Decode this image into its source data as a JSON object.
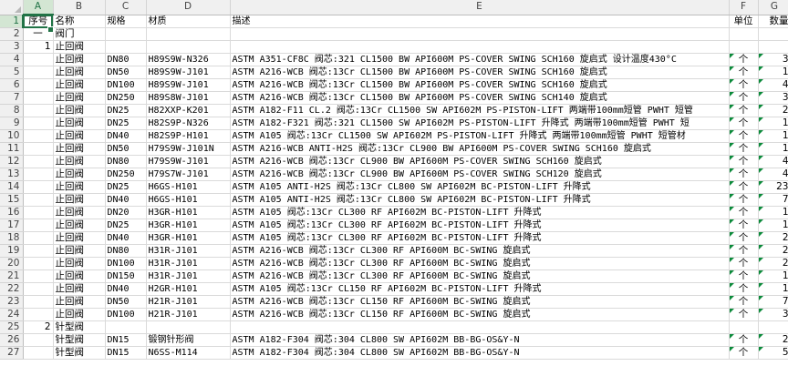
{
  "columns": [
    "A",
    "B",
    "C",
    "D",
    "E",
    "F",
    "G"
  ],
  "rows": [
    {
      "n": "1",
      "a": "序号",
      "b": "名称",
      "c": "规格",
      "d": "材质",
      "e": "描述",
      "f": "单位",
      "g": "数量"
    },
    {
      "n": "2",
      "a": "一",
      "b": "阀门",
      "c": "",
      "d": "",
      "e": "",
      "f": "",
      "g": ""
    },
    {
      "n": "3",
      "a": "1",
      "b": "止回阀",
      "c": "",
      "d": "",
      "e": "",
      "f": "",
      "g": ""
    },
    {
      "n": "4",
      "a": "",
      "b": "止回阀",
      "c": "DN80",
      "d": "H89S9W-N326",
      "e": "ASTM A351-CF8C 阀芯:321 CL1500 BW API600M PS-COVER SWING SCH160 旋启式 设计温度430°C",
      "f": "个",
      "g": "3"
    },
    {
      "n": "5",
      "a": "",
      "b": "止回阀",
      "c": "DN50",
      "d": "H89S9W-J101",
      "e": "ASTM A216-WCB 阀芯:13Cr CL1500 BW API600M PS-COVER SWING SCH160 旋启式",
      "f": "个",
      "g": "1"
    },
    {
      "n": "6",
      "a": "",
      "b": "止回阀",
      "c": "DN100",
      "d": "H89S9W-J101",
      "e": "ASTM A216-WCB 阀芯:13Cr CL1500 BW API600M PS-COVER SWING SCH160 旋启式",
      "f": "个",
      "g": "4"
    },
    {
      "n": "7",
      "a": "",
      "b": "止回阀",
      "c": "DN250",
      "d": "H89S8W-J101",
      "e": "ASTM A216-WCB 阀芯:13Cr CL1500 BW API600M PS-COVER SWING SCH140 旋启式",
      "f": "个",
      "g": "3"
    },
    {
      "n": "8",
      "a": "",
      "b": "止回阀",
      "c": "DN25",
      "d": "H82XXP-K201",
      "e": "ASTM A182-F11 CL.2 阀芯:13Cr CL1500 SW API602M PS-PISTON-LIFT 两端带100mm短管 PWHT 短管",
      "f": "个",
      "g": "2"
    },
    {
      "n": "9",
      "a": "",
      "b": "止回阀",
      "c": "DN25",
      "d": "H82S9P-N326",
      "e": "ASTM A182-F321 阀芯:321 CL1500 SW API602M PS-PISTON-LIFT 升降式 两端带100mm短管 PWHT 短",
      "f": "个",
      "g": "1"
    },
    {
      "n": "10",
      "a": "",
      "b": "止回阀",
      "c": "DN40",
      "d": "H82S9P-H101",
      "e": "ASTM A105 阀芯:13Cr CL1500 SW API602M PS-PISTON-LIFT 升降式 两端带100mm短管 PWHT 短管材",
      "f": "个",
      "g": "1"
    },
    {
      "n": "11",
      "a": "",
      "b": "止回阀",
      "c": "DN50",
      "d": "H79S9W-J101N",
      "e": "ASTM A216-WCB ANTI-H2S 阀芯:13Cr CL900 BW API600M PS-COVER SWING SCH160 旋启式",
      "f": "个",
      "g": "1"
    },
    {
      "n": "12",
      "a": "",
      "b": "止回阀",
      "c": "DN80",
      "d": "H79S9W-J101",
      "e": "ASTM A216-WCB 阀芯:13Cr CL900 BW API600M PS-COVER SWING SCH160 旋启式",
      "f": "个",
      "g": "4"
    },
    {
      "n": "13",
      "a": "",
      "b": "止回阀",
      "c": "DN250",
      "d": "H79S7W-J101",
      "e": "ASTM A216-WCB 阀芯:13Cr CL900 BW API600M PS-COVER SWING SCH120 旋启式",
      "f": "个",
      "g": "4"
    },
    {
      "n": "14",
      "a": "",
      "b": "止回阀",
      "c": "DN25",
      "d": "H6GS-H101",
      "e": "ASTM A105 ANTI-H2S 阀芯:13Cr CL800 SW API602M BC-PISTON-LIFT 升降式",
      "f": "个",
      "g": "23"
    },
    {
      "n": "15",
      "a": "",
      "b": "止回阀",
      "c": "DN40",
      "d": "H6GS-H101",
      "e": "ASTM A105 ANTI-H2S 阀芯:13Cr CL800 SW API602M BC-PISTON-LIFT 升降式",
      "f": "个",
      "g": "7"
    },
    {
      "n": "16",
      "a": "",
      "b": "止回阀",
      "c": "DN20",
      "d": "H3GR-H101",
      "e": "ASTM A105 阀芯:13Cr CL300 RF API602M BC-PISTON-LIFT 升降式",
      "f": "个",
      "g": "1"
    },
    {
      "n": "17",
      "a": "",
      "b": "止回阀",
      "c": "DN25",
      "d": "H3GR-H101",
      "e": "ASTM A105 阀芯:13Cr CL300 RF API602M BC-PISTON-LIFT 升降式",
      "f": "个",
      "g": "1"
    },
    {
      "n": "18",
      "a": "",
      "b": "止回阀",
      "c": "DN40",
      "d": "H3GR-H101",
      "e": "ASTM A105 阀芯:13Cr CL300 RF API602M BC-PISTON-LIFT 升降式",
      "f": "个",
      "g": "2"
    },
    {
      "n": "19",
      "a": "",
      "b": "止回阀",
      "c": "DN80",
      "d": "H31R-J101",
      "e": "ASTM A216-WCB 阀芯:13Cr CL300 RF API600M BC-SWING 旋启式",
      "f": "个",
      "g": "2"
    },
    {
      "n": "20",
      "a": "",
      "b": "止回阀",
      "c": "DN100",
      "d": "H31R-J101",
      "e": "ASTM A216-WCB 阀芯:13Cr CL300 RF API600M BC-SWING 旋启式",
      "f": "个",
      "g": "2"
    },
    {
      "n": "21",
      "a": "",
      "b": "止回阀",
      "c": "DN150",
      "d": "H31R-J101",
      "e": "ASTM A216-WCB 阀芯:13Cr CL300 RF API600M BC-SWING 旋启式",
      "f": "个",
      "g": "1"
    },
    {
      "n": "22",
      "a": "",
      "b": "止回阀",
      "c": "DN40",
      "d": "H2GR-H101",
      "e": "ASTM A105 阀芯:13Cr CL150 RF API602M BC-PISTON-LIFT 升降式",
      "f": "个",
      "g": "1"
    },
    {
      "n": "23",
      "a": "",
      "b": "止回阀",
      "c": "DN50",
      "d": "H21R-J101",
      "e": "ASTM A216-WCB 阀芯:13Cr CL150 RF API600M BC-SWING 旋启式",
      "f": "个",
      "g": "7"
    },
    {
      "n": "24",
      "a": "",
      "b": "止回阀",
      "c": "DN100",
      "d": "H21R-J101",
      "e": "ASTM A216-WCB 阀芯:13Cr CL150 RF API600M BC-SWING 旋启式",
      "f": "个",
      "g": "3"
    },
    {
      "n": "25",
      "a": "2",
      "b": "针型阀",
      "c": "",
      "d": "",
      "e": "",
      "f": "",
      "g": ""
    },
    {
      "n": "26",
      "a": "",
      "b": "针型阀",
      "c": "DN15",
      "d": "锻钢针形阀",
      "e": "ASTM A182-F304 阀芯:304 CL800 SW API602M BB-BG-OS&Y-N",
      "f": "个",
      "g": "2"
    },
    {
      "n": "27",
      "a": "",
      "b": "针型阀",
      "c": "DN15",
      "d": "N6SS-M114",
      "e": "ASTM A182-F304 阀芯:304 CL800 SW API602M BB-BG-OS&Y-N",
      "f": "个",
      "g": "5"
    }
  ]
}
